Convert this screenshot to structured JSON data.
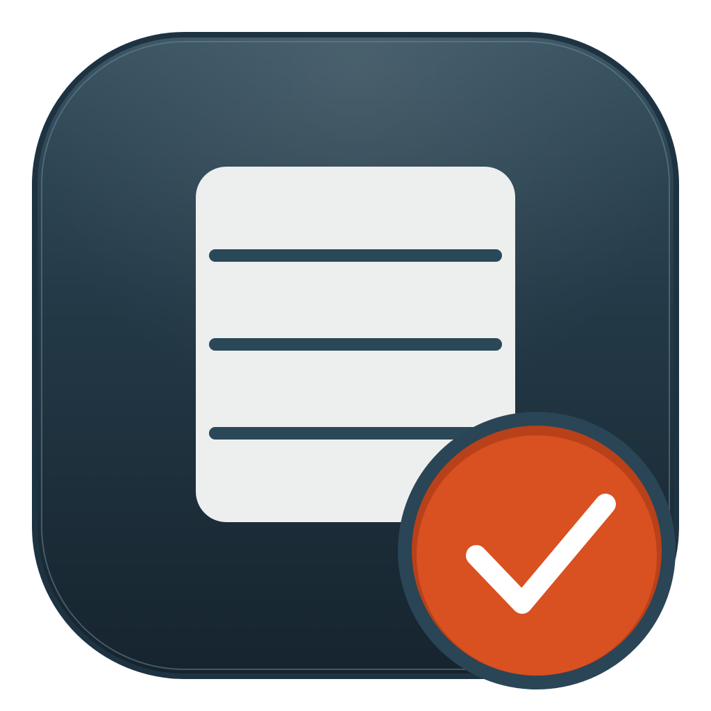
{
  "app_icon": {
    "name": "document-check-app-icon",
    "colors": {
      "tile_top": "#36505f",
      "tile_bottom": "#16242e",
      "tile_border": "#1e3342",
      "tile_inner_highlight": "#6b8594",
      "page_fill": "#edeeee",
      "page_lines": "#2a4858",
      "badge_ring": "#2a4556",
      "badge_fill": "#d95021",
      "badge_rim_shadow": "#b8411a",
      "check_mark": "#ffffff"
    },
    "icons": {
      "page": "document-icon",
      "badge": "checkmark-icon"
    },
    "page_line_count": 3
  }
}
